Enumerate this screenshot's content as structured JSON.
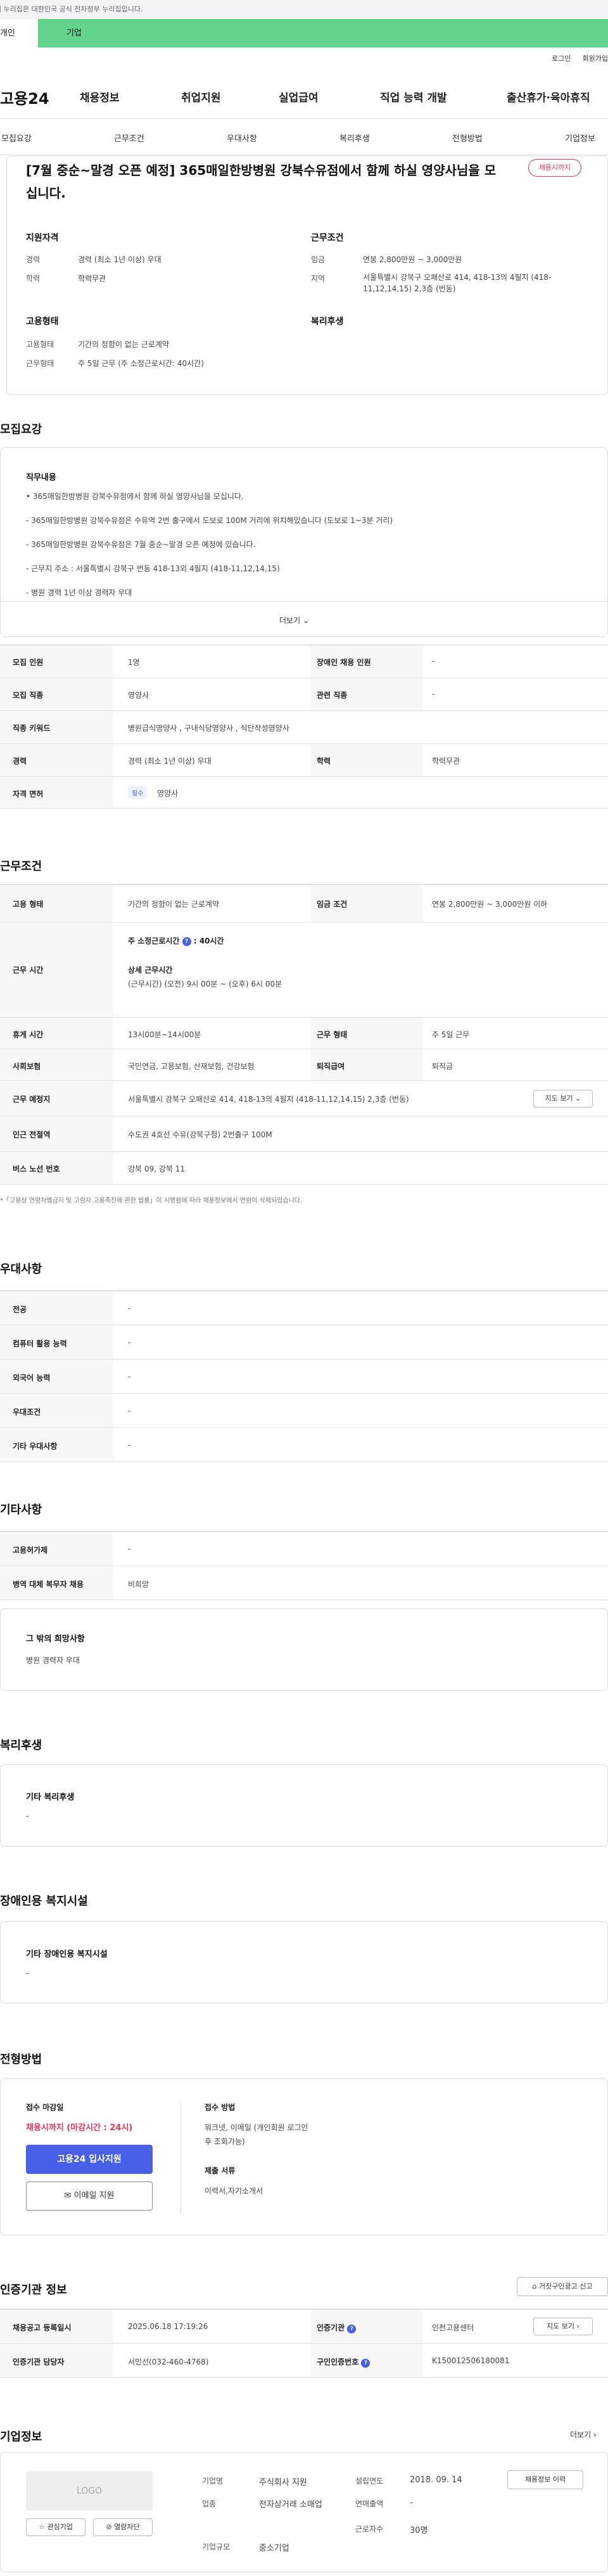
{
  "gov_banner": "이 누리집은 대한민국 공식 전자정부 누리집입니다.",
  "tabs": {
    "personal": "개인",
    "company": "기업"
  },
  "util": {
    "login": "로그인",
    "join": "회원가입"
  },
  "logo": "고용24",
  "gnb": [
    "채용정보",
    "취업지원",
    "실업급여",
    "직업 능력 개발",
    "출산휴가·육아휴직"
  ],
  "anchors": [
    "모집요강",
    "근무조건",
    "우대사항",
    "복리후생",
    "전형방법",
    "기업정보"
  ],
  "summary": {
    "title": "[7월 중순~말경 오픈 예정] 365매일한방병원 강북수유점에서 함께 하실 영양사님을 모십니다.",
    "badge": "채용시까지",
    "req_title": "지원자격",
    "career_lbl": "경력",
    "career": "경력 (최소 1년 이상) 우대",
    "edu_lbl": "학력",
    "edu": "학력무관",
    "cond_title": "근무조건",
    "wage_lbl": "임금",
    "wage": "연봉 2,800만원 ~ 3,000만원",
    "region_lbl": "지역",
    "region": "서울특별시 강북구 오패산로 414, 418-13의 4필지 (418-11,12,14,15) 2,3층 (번동)",
    "form_title": "고용형태",
    "emp_lbl": "고용형태",
    "emp": "기간의 정함이 없는 근로계약",
    "work_lbl": "근무형태",
    "work": "주 5일 근무 (주 소정근로시간: 40시간)",
    "welfare_title": "복리후생"
  },
  "recruit": {
    "section": "모집요강",
    "job_lbl": "직무내용",
    "lines": [
      "• 365매일한방병원 강북수유점에서 함께 하실 영양사님을 모십니다.",
      "- 365매일한방병원 강북수유점은 수유역 2번 출구에서 도보로 100M 거리에 위치해있습니다 (도보로 1~3분 거리)",
      "- 365매일한방병원 강북수유점은 7월 중순~말경 오픈 예정에 있습니다.",
      "- 근무지 주소 : 서울특별시 강북구 번동 418-13외 4필지 (418-11,12,14,15)",
      "- 병원 경력 1년 이상 경력자 우대"
    ],
    "more": "더보기",
    "table": [
      {
        "l1": "모집 인원",
        "v1": "1명",
        "l2": "장애인 채용 인원",
        "v2": "-"
      },
      {
        "l1": "모집 직종",
        "v1": "영양사",
        "l2": "관련 직종",
        "v2": "-"
      },
      {
        "l1": "직종 키워드",
        "v1": "병원급식영양사 , 구내식당영양사 , 식단작성영양사",
        "l2": "",
        "v2": ""
      },
      {
        "l1": "경력",
        "v1": "경력 (최소 1년 이상) 우대",
        "l2": "학력",
        "v2": "학력무관"
      },
      {
        "l1": "자격 면허",
        "v1": "영양사",
        "l2": "",
        "v2": ""
      }
    ],
    "required_tag": "필수"
  },
  "conditions": {
    "section": "근무조건",
    "emp_lbl": "고용 형태",
    "emp": "기간의 정함이 없는 근로계약",
    "wage_lbl": "임금 조건",
    "wage": "연봉 2,800만원 ~ 3,000만원 이하",
    "hours_lbl": "근무 시간",
    "weekly": "주 소정근로시간",
    "weekly_val": ": 40시간",
    "detail_title": "상세 근무시간",
    "detail": "(근무시간) (오전) 9시 00분 ~ (오후) 6시 00분",
    "break_lbl": "휴게 시간",
    "break": "13시00분~14시00분",
    "form_lbl": "근무 형태",
    "form": "주 5일 근무",
    "ins_lbl": "사회보험",
    "ins": "국민연금, 고용보험, 산재보험, 건강보험",
    "sev_lbl": "퇴직급여",
    "sev": "퇴직금",
    "place_lbl": "근무 예정지",
    "place": "서울특별시 강북구 오패산로 414, 418-13의 4필지 (418-11,12,14,15) 2,3층 (번동)",
    "map_btn": "지도 보기",
    "subway_lbl": "인근 전철역",
    "subway": "수도권 4호선 수유(강북구청) 2번출구 100M",
    "bus_lbl": "버스 노선 번호",
    "bus": "강북 09, 강북 11",
    "notice": "*「고용상 연령차별금지 및 고령자 고용촉진에 관한 법률」이 시행됨에 따라 채용정보에서 연령이 삭제되었습니다."
  },
  "pref": {
    "section": "우대사항",
    "rows": [
      {
        "l": "전공",
        "v": "-"
      },
      {
        "l": "컴퓨터 활용 능력",
        "v": "-"
      },
      {
        "l": "외국어 능력",
        "v": "-"
      },
      {
        "l": "우대조건",
        "v": "-"
      },
      {
        "l": "기타 우대사항",
        "v": "-"
      }
    ]
  },
  "etc": {
    "section": "기타사항",
    "rows": [
      {
        "l": "고용허가제",
        "v": "-"
      },
      {
        "l": "병역 대체 복무자 채용",
        "v": "비희망"
      }
    ],
    "hope_title": "그 밖의 희망사항",
    "hope": "병원 경력자 우대"
  },
  "welfare": {
    "section": "복리후생",
    "title": "기타 복리후생",
    "value": "-"
  },
  "disabled": {
    "section": "장애인용 복지시설",
    "title": "기타 장애인용 복지시설",
    "value": "-"
  },
  "process": {
    "section": "전형방법",
    "deadline_lbl": "접수 마감일",
    "deadline": "채용시까지 (마감시간 : 24시)",
    "apply_btn": "고용24 입사지원",
    "email_btn": "이메일 지원",
    "method_lbl": "접수 방법",
    "method": "워크넷, 이메일 (개인회원 로그인 후 조회가능)",
    "docs_lbl": "제출 서류",
    "docs": "이력서,자기소개서"
  },
  "cert": {
    "section": "인증기관 정보",
    "report_btn": "거짓구인광고 신고",
    "reg_lbl": "채용공고 등록일시",
    "reg": "2025.06.18 17:19:26",
    "org_lbl": "인증기관",
    "org": "인천고용센터",
    "map_btn": "지도 보기",
    "mgr_lbl": "인증기관 담당자",
    "mgr": "서민선(032-460-4768)",
    "no_lbl": "구인인증번호",
    "no": "K150012506180081"
  },
  "company": {
    "section": "기업정보",
    "more": "더보기",
    "logo": "LOGO",
    "interest_btn": "관심기업",
    "block_btn": "열람차단",
    "jobs_btn": "채용정보 이력",
    "name_lbl": "기업명",
    "name": "주식회사 지원",
    "found_lbl": "설립연도",
    "found": "2018. 09. 14",
    "ind_lbl": "업종",
    "ind": "전자상거래 소매업",
    "sales_lbl": "연매출액",
    "sales": "-",
    "size_lbl": "기업규모",
    "size": "중소기업",
    "emp_lbl": "근로자수",
    "emp": "30명"
  }
}
